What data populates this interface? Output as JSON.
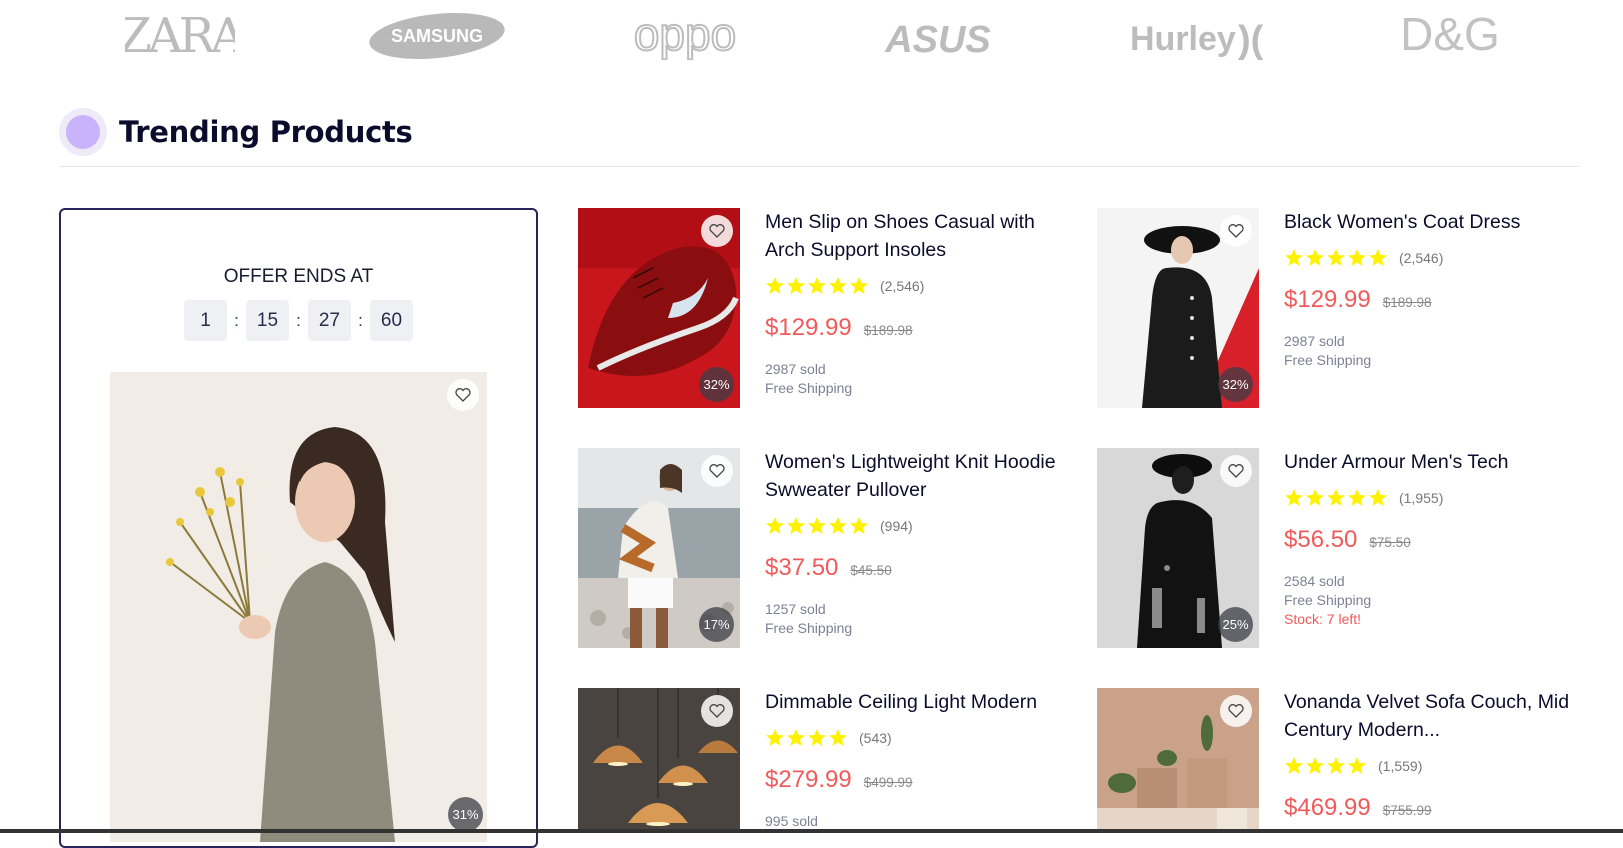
{
  "brands": [
    "ZARA",
    "SAMSUNG",
    "oppo",
    "ASUS",
    "Hurley",
    "D&G"
  ],
  "section": {
    "title": "Trending Products"
  },
  "offer": {
    "title": "OFFER ENDS AT",
    "timer": [
      "1",
      "15",
      "27",
      "60"
    ],
    "separator": ":",
    "badge": "31%"
  },
  "products": [
    {
      "name": "Men Slip on Shoes Casual with Arch Support Insoles",
      "stars": 5,
      "reviews": "(2,546)",
      "price": "$129.99",
      "old_price": "$189.98",
      "sold": "2987 sold",
      "shipping": "Free Shipping",
      "stock": "",
      "badge": "32%"
    },
    {
      "name": "Black Women's Coat Dress",
      "stars": 5,
      "reviews": "(2,546)",
      "price": "$129.99",
      "old_price": "$189.98",
      "sold": "2987 sold",
      "shipping": "Free Shipping",
      "stock": "",
      "badge": "32%"
    },
    {
      "name": "Women's Lightweight Knit Hoodie Swweater Pullover",
      "stars": 5,
      "reviews": "(994)",
      "price": "$37.50",
      "old_price": "$45.50",
      "sold": "1257 sold",
      "shipping": "Free Shipping",
      "stock": "",
      "badge": "17%"
    },
    {
      "name": "Under Armour Men's Tech",
      "stars": 5,
      "reviews": "(1,955)",
      "price": "$56.50",
      "old_price": "$75.50",
      "sold": "2584 sold",
      "shipping": "Free Shipping",
      "stock": "Stock: 7 left!",
      "badge": "25%"
    },
    {
      "name": "Dimmable Ceiling Light Modern",
      "stars": 4,
      "reviews": "(543)",
      "price": "$279.99",
      "old_price": "$499.99",
      "sold": "995 sold",
      "shipping": "",
      "stock": "",
      "badge": ""
    },
    {
      "name": "Vonanda Velvet Sofa Couch, Mid Century Modern...",
      "stars": 4,
      "reviews": "(1,559)",
      "price": "$469.99",
      "old_price": "$755.99",
      "sold": "",
      "shipping": "",
      "stock": "",
      "badge": ""
    }
  ],
  "colors": {
    "accent": "#f05a5a",
    "star": "#fff200",
    "border": "#26245a",
    "dot": "#c9b3fa"
  }
}
